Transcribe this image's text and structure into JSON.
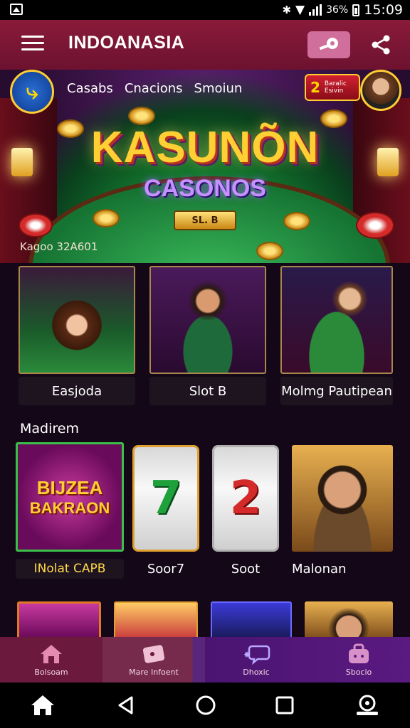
{
  "status_bar": {
    "battery": "36%",
    "time": "15:09"
  },
  "app_bar": {
    "title": "INDOANASIA"
  },
  "hero": {
    "tabs": [
      "Casabs",
      "Cnacions",
      "Smoiun"
    ],
    "coin_badge": {
      "value": "2",
      "label_line1": "Baralic",
      "label_line2": "Esivin"
    },
    "title": "KASUNÕN",
    "subtitle": "CASONOS",
    "plaque": "SL. B",
    "caption": "Kagoo 32A601"
  },
  "featured": [
    {
      "label": "Easjoda"
    },
    {
      "label": "Slot B"
    },
    {
      "label": "Molmg Pautipean"
    }
  ],
  "section": {
    "label": "Madirem"
  },
  "games": [
    {
      "label": "INolat CAPB",
      "art_line1": "BIJZEA",
      "art_line2": "BAKRAON"
    },
    {
      "label": "Soor7",
      "reel_symbol": "7"
    },
    {
      "label": "Soot",
      "reel_symbol": "2"
    },
    {
      "label": "Malonan"
    }
  ],
  "bottom_nav": [
    {
      "label": "Bolsoam",
      "icon": "home-icon"
    },
    {
      "label": "Mare Infoent",
      "icon": "card-icon"
    },
    {
      "label": "Dhoxic",
      "icon": "chat-icon"
    },
    {
      "label": "Sbocio",
      "icon": "bag-icon"
    }
  ],
  "colors": {
    "appbar": "#8a1a3a",
    "accent_gold": "#ffcf33",
    "felt_green": "#2aa84a"
  }
}
